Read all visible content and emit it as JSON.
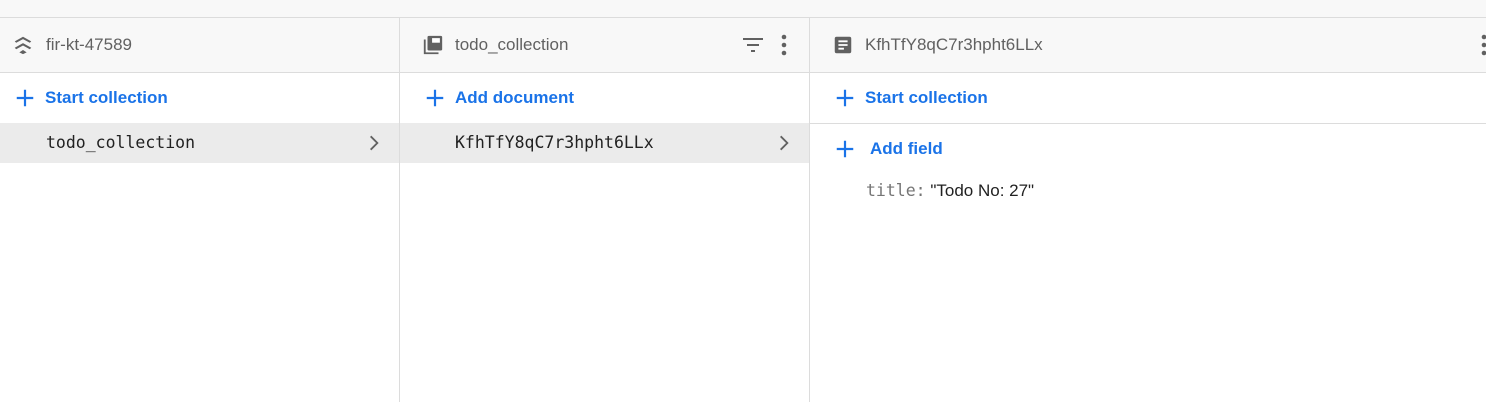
{
  "colors": {
    "accent": "#1a73e8",
    "header_bg": "#f8f8f8",
    "selected_bg": "#ebebeb",
    "border": "#dcdcdc"
  },
  "root_panel": {
    "title": "fir-kt-47589",
    "icon": "firestore-stack-icon",
    "action_label": "Start collection",
    "items": [
      {
        "label": "todo_collection",
        "selected": true
      }
    ]
  },
  "collection_panel": {
    "title": "todo_collection",
    "icon": "collection-icon",
    "action_label": "Add document",
    "items": [
      {
        "label": "KfhTfY8qC7r3hpht6LLx",
        "selected": true
      }
    ]
  },
  "document_panel": {
    "title": "KfhTfY8qC7r3hpht6LLx",
    "icon": "document-icon",
    "action_label": "Start collection",
    "add_field_label": "Add field",
    "fields": [
      {
        "key": "title:",
        "value": "\"Todo No: 27\""
      }
    ]
  }
}
